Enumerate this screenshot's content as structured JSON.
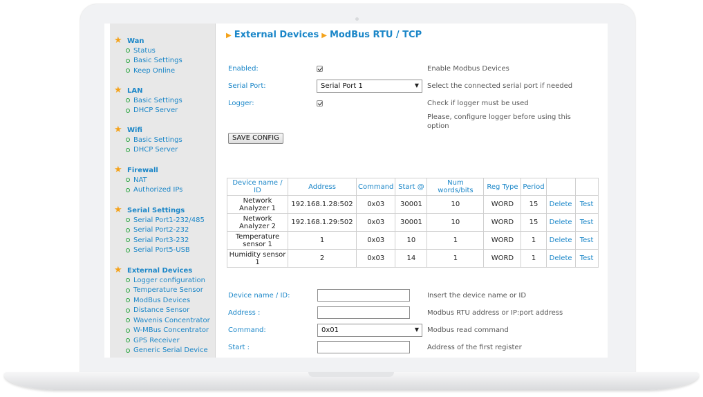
{
  "sidebar": {
    "sections": [
      {
        "title": "Wan",
        "items": [
          "Status",
          "Basic Settings",
          "Keep Online"
        ]
      },
      {
        "title": "LAN",
        "items": [
          "Basic Settings",
          "DHCP Server"
        ]
      },
      {
        "title": "Wifi",
        "items": [
          "Basic Settings",
          "DHCP Server"
        ]
      },
      {
        "title": "Firewall",
        "items": [
          "NAT",
          "Authorized IPs"
        ]
      },
      {
        "title": "Serial Settings",
        "items": [
          "Serial Port1-232/485",
          "Serial Port2-232",
          "Serial Port3-232",
          "Serial Port5-USB"
        ]
      },
      {
        "title": "External Devices",
        "items": [
          "Logger configuration",
          "Temperature Sensor",
          "ModBus Devices",
          "Distance Sensor",
          "Wavenis Concentrator",
          "W-MBus Concentrator",
          "GPS Receiver",
          "Generic Serial Device"
        ]
      }
    ]
  },
  "breadcrumb": {
    "part1": "External Devices",
    "part2": "ModBus RTU / TCP"
  },
  "config": {
    "enabled_label": "Enabled:",
    "enabled_checked": true,
    "enabled_help": "Enable Modbus Devices",
    "serial_port_label": "Serial Port:",
    "serial_port_value": "Serial Port 1",
    "serial_port_help": "Select the connected serial port if needed",
    "logger_label": "Logger:",
    "logger_checked": true,
    "logger_help": "Check if logger must be used",
    "logger_note": "Please, configure logger before using this option",
    "save_button": "SAVE CONFIG"
  },
  "table": {
    "headers": [
      "Device name / ID",
      "Address",
      "Command",
      "Start @",
      "Num words/bits",
      "Reg Type",
      "Period"
    ],
    "rows": [
      [
        "Network Analyzer 1",
        "192.168.1.28:502",
        "0x03",
        "30001",
        "10",
        "WORD",
        "15"
      ],
      [
        "Network Analyzer 2",
        "192.168.1.29:502",
        "0x03",
        "30001",
        "10",
        "WORD",
        "15"
      ],
      [
        "Temperature sensor 1",
        "1",
        "0x03",
        "10",
        "1",
        "WORD",
        "1"
      ],
      [
        "Humidity sensor 1",
        "2",
        "0x03",
        "14",
        "1",
        "WORD",
        "1"
      ]
    ],
    "delete_label": "Delete",
    "test_label": "Test"
  },
  "form": {
    "device_label": "Device name / ID:",
    "device_value": "",
    "device_help": "Insert the device name or ID",
    "address_label": "Address :",
    "address_value": "",
    "address_help": "Modbus RTU address or IP:port address",
    "command_label": "Command:",
    "command_value": "0x01",
    "command_help": "Modbus read command",
    "start_label": "Start :",
    "start_value": "",
    "start_help": "Address of the first register"
  },
  "icons": {
    "section": "star-icon",
    "item": "bullet-icon",
    "crumb": "triangle-right-icon",
    "dropdown": "chevron-down-icon"
  },
  "colors": {
    "link": "#1a86c8",
    "star": "#f4a21a",
    "bullet": "#23a23a",
    "sidebar_bg": "#e8e8e8"
  }
}
